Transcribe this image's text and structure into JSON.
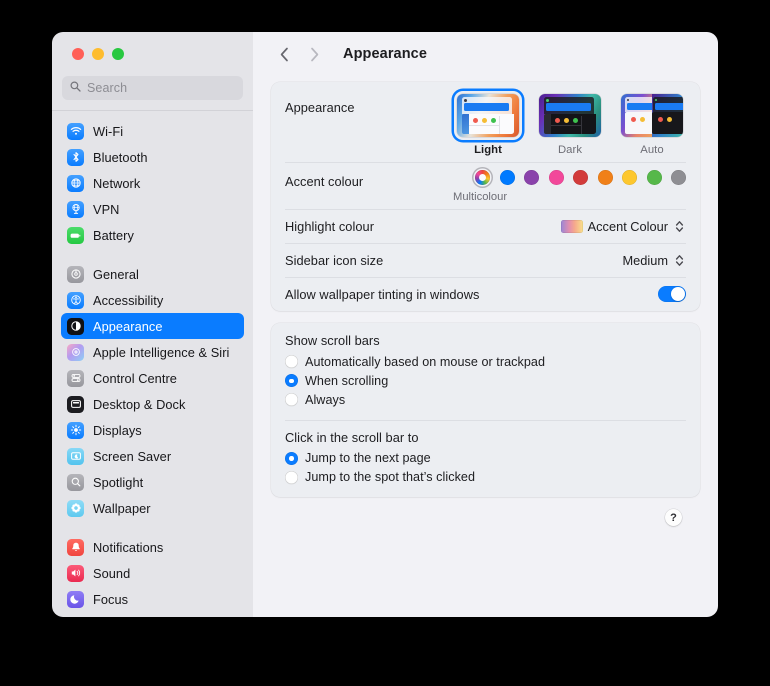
{
  "window": {
    "traffic_lights": [
      "close",
      "minimize",
      "zoom"
    ],
    "title": "Appearance",
    "back_icon": "chevron-left-icon",
    "forward_icon": "chevron-right-icon"
  },
  "sidebar": {
    "search": {
      "placeholder": "Search",
      "value": "",
      "icon": "search-icon"
    },
    "groups": [
      {
        "items": [
          {
            "label": "Wi-Fi",
            "icon": "wifi-icon",
            "selected": false
          },
          {
            "label": "Bluetooth",
            "icon": "bluetooth-icon",
            "selected": false
          },
          {
            "label": "Network",
            "icon": "network-globe-icon",
            "selected": false
          },
          {
            "label": "VPN",
            "icon": "vpn-icon",
            "selected": false
          },
          {
            "label": "Battery",
            "icon": "battery-icon",
            "selected": false
          }
        ]
      },
      {
        "items": [
          {
            "label": "General",
            "icon": "gear-icon",
            "selected": false
          },
          {
            "label": "Accessibility",
            "icon": "accessibility-icon",
            "selected": false
          },
          {
            "label": "Appearance",
            "icon": "appearance-contrast-icon",
            "selected": true
          },
          {
            "label": "Apple Intelligence & Siri",
            "icon": "siri-icon",
            "selected": false
          },
          {
            "label": "Control Centre",
            "icon": "control-centre-icon",
            "selected": false
          },
          {
            "label": "Desktop & Dock",
            "icon": "desktop-dock-icon",
            "selected": false
          },
          {
            "label": "Displays",
            "icon": "displays-brightness-icon",
            "selected": false
          },
          {
            "label": "Screen Saver",
            "icon": "screen-saver-icon",
            "selected": false
          },
          {
            "label": "Spotlight",
            "icon": "spotlight-search-icon",
            "selected": false
          },
          {
            "label": "Wallpaper",
            "icon": "wallpaper-flower-icon",
            "selected": false
          }
        ]
      },
      {
        "items": [
          {
            "label": "Notifications",
            "icon": "notifications-bell-icon",
            "selected": false
          },
          {
            "label": "Sound",
            "icon": "sound-speaker-icon",
            "selected": false
          },
          {
            "label": "Focus",
            "icon": "focus-moon-icon",
            "selected": false
          }
        ]
      }
    ]
  },
  "main": {
    "appearance_row": {
      "label": "Appearance",
      "themes": [
        {
          "name": "Light",
          "selected": true
        },
        {
          "name": "Dark",
          "selected": false
        },
        {
          "name": "Auto",
          "selected": false
        }
      ]
    },
    "accent_row": {
      "label": "Accent colour",
      "caption": "Multicolour",
      "swatches": [
        {
          "name": "multicolour",
          "color": "multicolour",
          "selected": true
        },
        {
          "name": "blue",
          "color": "#007aff",
          "selected": false
        },
        {
          "name": "purple",
          "color": "#8a42ab",
          "selected": false
        },
        {
          "name": "pink",
          "color": "#f2489a",
          "selected": false
        },
        {
          "name": "red",
          "color": "#d23b3b",
          "selected": false
        },
        {
          "name": "orange",
          "color": "#f08019",
          "selected": false
        },
        {
          "name": "yellow",
          "color": "#fdc72e",
          "selected": false
        },
        {
          "name": "green",
          "color": "#56b84a",
          "selected": false
        },
        {
          "name": "graphite",
          "color": "#8e8e93",
          "selected": false
        }
      ]
    },
    "highlight_row": {
      "label": "Highlight colour",
      "value": "Accent Colour"
    },
    "sidebar_icon_row": {
      "label": "Sidebar icon size",
      "value": "Medium"
    },
    "wallpaper_tint_row": {
      "label": "Allow wallpaper tinting in windows",
      "enabled": true
    },
    "scrollbars_group": {
      "heading": "Show scroll bars",
      "options": [
        {
          "label": "Automatically based on mouse or trackpad",
          "selected": false
        },
        {
          "label": "When scrolling",
          "selected": true
        },
        {
          "label": "Always",
          "selected": false
        }
      ]
    },
    "scrollbar_click_group": {
      "heading": "Click in the scroll bar to",
      "options": [
        {
          "label": "Jump to the next page",
          "selected": true
        },
        {
          "label": "Jump to the spot that’s clicked",
          "selected": false
        }
      ]
    },
    "help_button": {
      "label": "?"
    }
  },
  "colors": {
    "accent": "#0a7cff",
    "window_bg": "#f2f2f6",
    "sidebar_bg": "#e4e4e8",
    "card_bg": "#eceef2",
    "page_bg": "#000000"
  }
}
